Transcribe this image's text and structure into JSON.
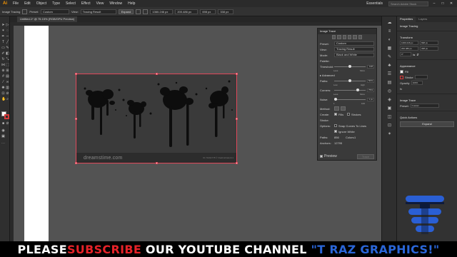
{
  "app": {
    "logo": "Ai",
    "menu": [
      "File",
      "Edit",
      "Object",
      "Type",
      "Select",
      "Effect",
      "View",
      "Window",
      "Help"
    ],
    "workspace": "Essentials",
    "search_placeholder": "Search Adobe Stock"
  },
  "controlbar": {
    "label": "Image Tracing",
    "preset_label": "Preset:",
    "preset_value": "Custom",
    "view_label": "View:",
    "view_value": "Tracing Result",
    "expand_button": "Expand",
    "field_values": [
      "1360.246 px",
      "200.486 px",
      "698 px",
      "338 px"
    ]
  },
  "document": {
    "tab_title": "Untitled-1* @ 75.15% (RGB/GPU Preview)"
  },
  "canvas": {
    "watermark": "dreamstime.com",
    "watermark_id": "ID 74491778 © Vladimirbaturin1"
  },
  "image_trace": {
    "title": "Image Trace",
    "preset_label": "Preset:",
    "preset_value": "Custom",
    "view_label": "View:",
    "view_value": "Tracing Result",
    "mode_label": "Mode:",
    "mode_value": "Black and White",
    "palette_label": "Palette:",
    "threshold_label": "Threshold:",
    "threshold_value": "128",
    "threshold": 0.5,
    "threshold_min": "Less",
    "threshold_max": "More",
    "advanced_label": "Advanced",
    "paths_label": "Paths:",
    "paths_value": "50%",
    "paths": 0.5,
    "paths_min": "Low",
    "paths_max": "High",
    "corners_label": "Corners:",
    "corners_value": "75%",
    "corners": 0.75,
    "corners_min": "Less",
    "corners_max": "More",
    "noise_label": "Noise:",
    "noise_value": "1 px",
    "noise": 0.05,
    "noise_min": "1",
    "noise_max": "100",
    "method_label": "Method:",
    "create_label": "Create:",
    "fills_label": "Fills",
    "strokes_label": "Strokes",
    "stroke_label": "Stroke:",
    "options_label": "Options:",
    "snap_label": "Snap Curves To Lines",
    "ignore_white_label": "Ignore White",
    "paths_count_label": "Paths:",
    "paths_count": "856",
    "colors_label": "Colors:",
    "colors_count": "1",
    "anchors_label": "Anchors:",
    "anchors_count": "12795",
    "preview_label": "Preview",
    "trace_button": "Trace"
  },
  "properties": {
    "tabs": [
      "Properties",
      "Layers"
    ],
    "type_label": "Image Tracing",
    "transform_label": "Transform",
    "x_value": "1360.246 px",
    "y_value": "200.486 px",
    "w_value": "698 px",
    "h_value": "338 px",
    "rotate_value": "0°",
    "appearance_label": "Appearance",
    "fill_label": "Fill",
    "stroke_label": "Stroke",
    "opacity_label": "Opacity",
    "opacity_value": "100%",
    "fx_label": "fx",
    "image_trace_label": "Image Trace",
    "preset_label": "Preset:",
    "preset_value": "Custom",
    "quick_actions_label": "Quick Actions",
    "expand_button": "Expand"
  },
  "banner": {
    "part1": "PLEASE ",
    "part2": "SUBSCRIBE",
    "part3": " OUR YOUTUBE CHANNEL ",
    "part4": "\"T RAZ GRAPHICS!\""
  },
  "colors": {
    "accent_red": "#e62228",
    "accent_blue": "#2a66d9",
    "selection": "#e0485a",
    "ai_orange": "#ff9a00"
  }
}
